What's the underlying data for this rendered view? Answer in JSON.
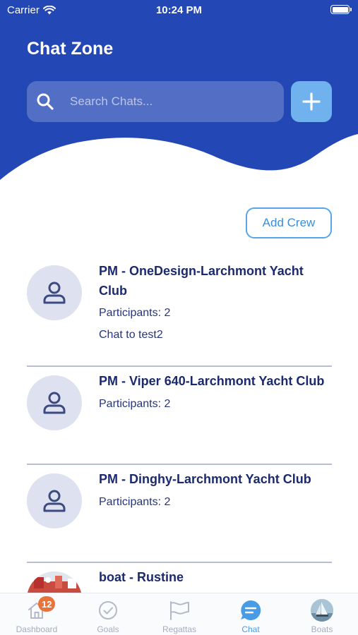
{
  "status_bar": {
    "carrier": "Carrier",
    "time": "10:24 PM"
  },
  "header": {
    "title": "Chat Zone",
    "accent_color": "#2347b5"
  },
  "search": {
    "placeholder": "Search Chats...",
    "value": ""
  },
  "add_chat": {
    "icon": "plus-icon"
  },
  "add_crew": {
    "label": "Add Crew"
  },
  "chats": [
    {
      "title": "PM - OneDesign-Larchmont Yacht Club",
      "participants": "Participants: 2",
      "last_message": "Chat to test2",
      "avatar": "user-icon"
    },
    {
      "title": "PM - Viper 640-Larchmont Yacht Club",
      "participants": "Participants: 2",
      "avatar": "user-icon"
    },
    {
      "title": "PM - Dinghy-Larchmont Yacht Club",
      "participants": "Participants: 2",
      "avatar": "user-icon"
    },
    {
      "title": "boat - Rustine",
      "avatar": "boat-photo"
    }
  ],
  "tabs": [
    {
      "label": "Dashboard",
      "icon": "home-icon",
      "badge": "12",
      "active": false
    },
    {
      "label": "Goals",
      "icon": "check-circle-icon",
      "active": false
    },
    {
      "label": "Regattas",
      "icon": "flag-icon",
      "active": false
    },
    {
      "label": "Chat",
      "icon": "chat-bubble-icon",
      "active": true
    },
    {
      "label": "Boats",
      "icon": "boat-photo",
      "active": false
    }
  ]
}
